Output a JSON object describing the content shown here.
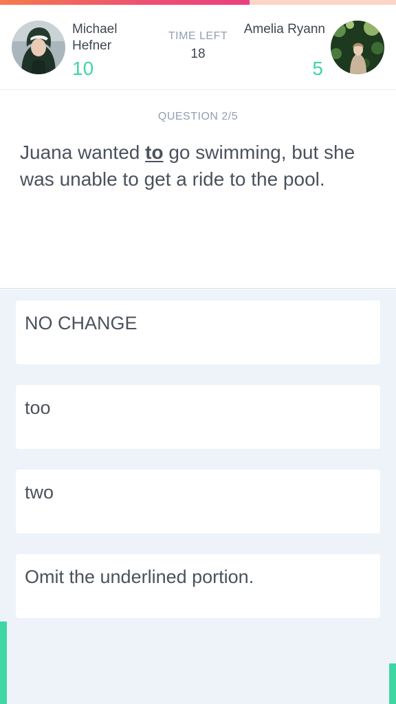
{
  "progress": {
    "fraction": 0.63,
    "fill_color": "#ee4f74",
    "track_color": "#fcd5c8"
  },
  "player_left": {
    "name": "Michael Hefner",
    "score": "10",
    "avatar_icon": "player-photo"
  },
  "player_right": {
    "name": "Amelia Ryann",
    "score": "5",
    "avatar_icon": "player-photo"
  },
  "timer": {
    "label": "TIME LEFT",
    "value": "18"
  },
  "question": {
    "number_label": "QUESTION 2/5",
    "text_before": "Juana wanted ",
    "underlined": "to",
    "text_after": " go swimming, but she was unable to get a ride to the pool."
  },
  "answers": [
    {
      "label": "NO CHANGE"
    },
    {
      "label": "too"
    },
    {
      "label": "two"
    },
    {
      "label": "Omit the underlined portion."
    }
  ],
  "colors": {
    "accent_green": "#3ed6a3",
    "answers_bg": "#edf3f9",
    "text": "#4a525c",
    "muted": "#8fa0b3"
  }
}
